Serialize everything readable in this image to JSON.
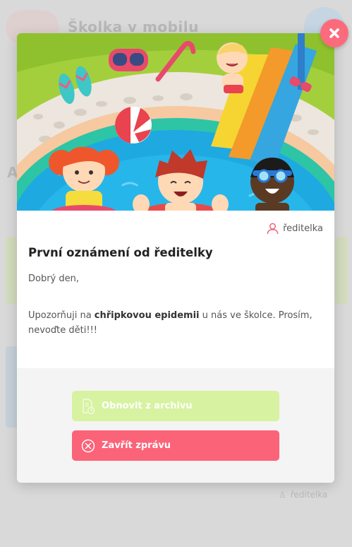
{
  "background": {
    "app_name": "Školka v mobilu",
    "section_letter": "A",
    "footer_author": "ředitelka"
  },
  "modal": {
    "author": "ředitelka",
    "title": "První oznámení od ředitelky",
    "greeting": "Dobrý den,",
    "body_part1": "Upozorňuji na ",
    "body_bold": "chřipkovou epidemii",
    "body_part2": " u nás ve školce. Prosím, nevoďte děti!!!",
    "buttons": {
      "restore": "Obnovit z archivu",
      "close": "Zavřít zprávu"
    }
  },
  "colors": {
    "close_button": "#fb6b7c",
    "restore_button": "#d7f2a0",
    "close_message_button": "#fb6379",
    "footer_bg": "#f4f4f4",
    "author_icon": "#f06479"
  },
  "icons": {
    "close": "close-icon",
    "author": "person-icon",
    "restore": "archive-document-icon",
    "close_message": "circle-x-icon"
  }
}
